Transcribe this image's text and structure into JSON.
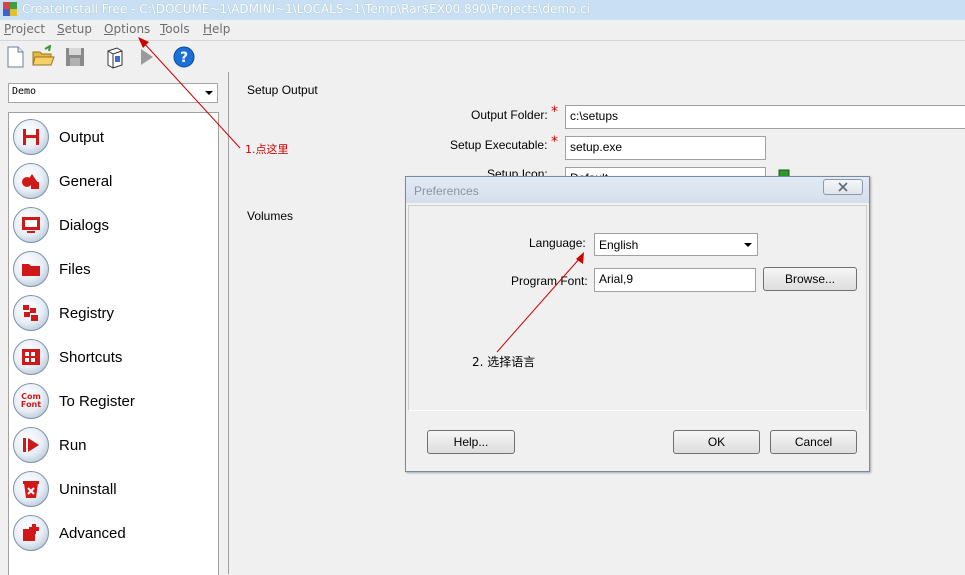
{
  "window": {
    "title": "CreateInstall Free - C:\\DOCUME~1\\ADMINI~1\\LOCALS~1\\Temp\\Rar$EX00.890\\Projects\\demo.ci"
  },
  "menu": [
    {
      "label": "Project",
      "u": "P",
      "rest": "roject"
    },
    {
      "label": "Setup",
      "u": "S",
      "rest": "etup"
    },
    {
      "label": "Options",
      "u": "O",
      "rest": "ptions"
    },
    {
      "label": "Tools",
      "u": "T",
      "rest": "ools"
    },
    {
      "label": "Help",
      "u": "H",
      "rest": "elp"
    }
  ],
  "toolbar": {
    "icons": [
      "new-icon",
      "open-folder-icon",
      "save-icon",
      "build-icon",
      "run-icon",
      "help-icon"
    ]
  },
  "project_combo": {
    "value": "Demo"
  },
  "nav": {
    "items": [
      {
        "label": "Output",
        "icon": "floppy-icon"
      },
      {
        "label": "General",
        "icon": "shapes-icon"
      },
      {
        "label": "Dialogs",
        "icon": "monitor-icon"
      },
      {
        "label": "Files",
        "icon": "folder-icon"
      },
      {
        "label": "Registry",
        "icon": "registry-icon"
      },
      {
        "label": "Shortcuts",
        "icon": "shortcuts-icon"
      },
      {
        "label": "To Register",
        "icon": "com-font-icon"
      },
      {
        "label": "Run",
        "icon": "run-icon"
      },
      {
        "label": "Uninstall",
        "icon": "uninstall-icon"
      },
      {
        "label": "Advanced",
        "icon": "advanced-icon"
      }
    ],
    "com_font_text": [
      "Com",
      "Font"
    ]
  },
  "main": {
    "setup_output_label": "Setup Output",
    "volumes_label": "Volumes",
    "output_folder_label": "Output Folder:",
    "output_folder_value": "c:\\setups",
    "setup_exe_label": "Setup Executable:",
    "setup_exe_value": "setup.exe",
    "setup_icon_label": "Setup Icon:",
    "setup_icon_value": "Default",
    "required_mark": "*"
  },
  "dialog": {
    "title": "Preferences",
    "language_label": "Language:",
    "language_value": "English",
    "font_label": "Program Font:",
    "font_value": "Arial,9",
    "browse_label": "Browse...",
    "help_label": "Help...",
    "ok_label": "OK",
    "cancel_label": "Cancel"
  },
  "annotations": {
    "step1": "1.点这里",
    "step2": "2.  选择语言",
    "color": "#d00000"
  }
}
